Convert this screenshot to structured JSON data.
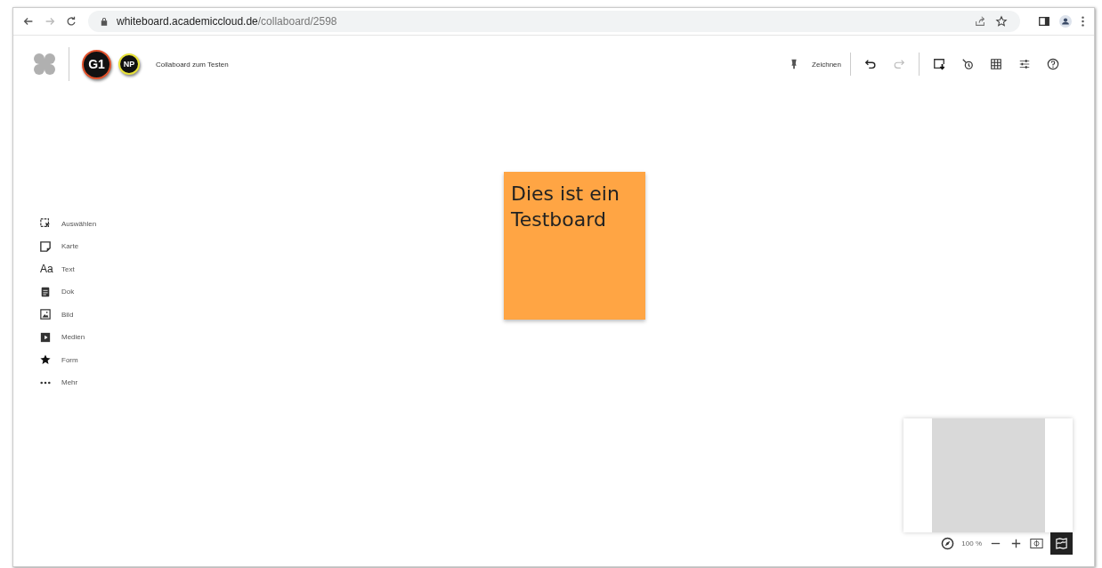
{
  "browser": {
    "url_host": "whiteboard.academiccloud.de",
    "url_path": "/collaboard/2598"
  },
  "header": {
    "avatars": [
      {
        "initials": "G1",
        "color": "#e0502a"
      },
      {
        "initials": "NP",
        "color": "#e8e23a"
      }
    ],
    "board_name": "Collaboard zum Testen"
  },
  "toolbar": {
    "draw_label": "Zeichnen",
    "redo_disabled": true
  },
  "tools": [
    {
      "kind": "select",
      "label": "Auswählen"
    },
    {
      "kind": "card",
      "label": "Karte"
    },
    {
      "kind": "text",
      "label": "Text",
      "glyph": "Aa"
    },
    {
      "kind": "doc",
      "label": "Dok"
    },
    {
      "kind": "image",
      "label": "Bild"
    },
    {
      "kind": "media",
      "label": "Medien"
    },
    {
      "kind": "shape",
      "label": "Form"
    },
    {
      "kind": "more",
      "label": "Mehr"
    }
  ],
  "sticky_note": {
    "text": "Dies ist ein Testboard",
    "color": "#ffa544"
  },
  "minimap": {
    "zoom": "100 %",
    "toggle_selected": true
  }
}
